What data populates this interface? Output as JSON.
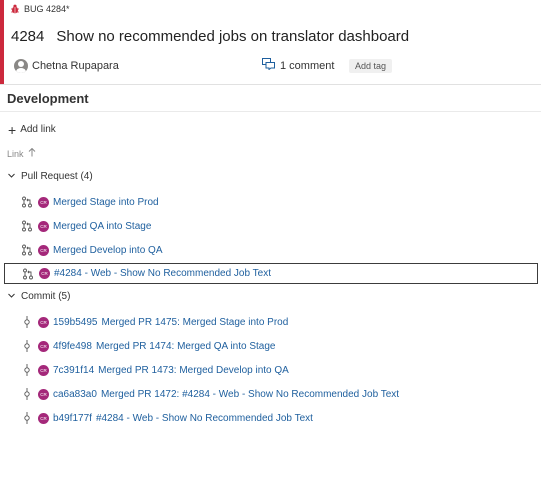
{
  "work_item": {
    "type_label": "BUG 4284*",
    "id": "4284",
    "title": "Show no recommended jobs on translator dashboard",
    "assignee": "Chetna Rupapara",
    "comments": "1 comment",
    "add_tag": "Add tag",
    "accent_color": "#cc293d"
  },
  "development": {
    "title": "Development",
    "add_link": "Add link",
    "sort_label": "Link"
  },
  "pull_requests": {
    "header": "Pull Request (4)",
    "items": [
      {
        "avatar": "CR",
        "text": "Merged Stage into Prod"
      },
      {
        "avatar": "CR",
        "text": "Merged QA into Stage"
      },
      {
        "avatar": "CR",
        "text": "Merged Develop into QA"
      },
      {
        "avatar": "CR",
        "text": "#4284 - Web - Show No Recommended Job Text"
      }
    ]
  },
  "commits": {
    "header": "Commit (5)",
    "items": [
      {
        "avatar": "CR",
        "hash": "159b5495",
        "text": "Merged PR 1475: Merged Stage into Prod"
      },
      {
        "avatar": "CR",
        "hash": "4f9fe498",
        "text": "Merged PR 1474: Merged QA into Stage"
      },
      {
        "avatar": "CR",
        "hash": "7c391f14",
        "text": "Merged PR 1473: Merged Develop into QA"
      },
      {
        "avatar": "CR",
        "hash": "ca6a83a0",
        "text": "Merged PR 1472: #4284 - Web - Show No Recommended Job Text"
      },
      {
        "avatar": "CR",
        "hash": "b49f177f",
        "text": "#4284 - Web - Show No Recommended Job Text"
      }
    ]
  }
}
